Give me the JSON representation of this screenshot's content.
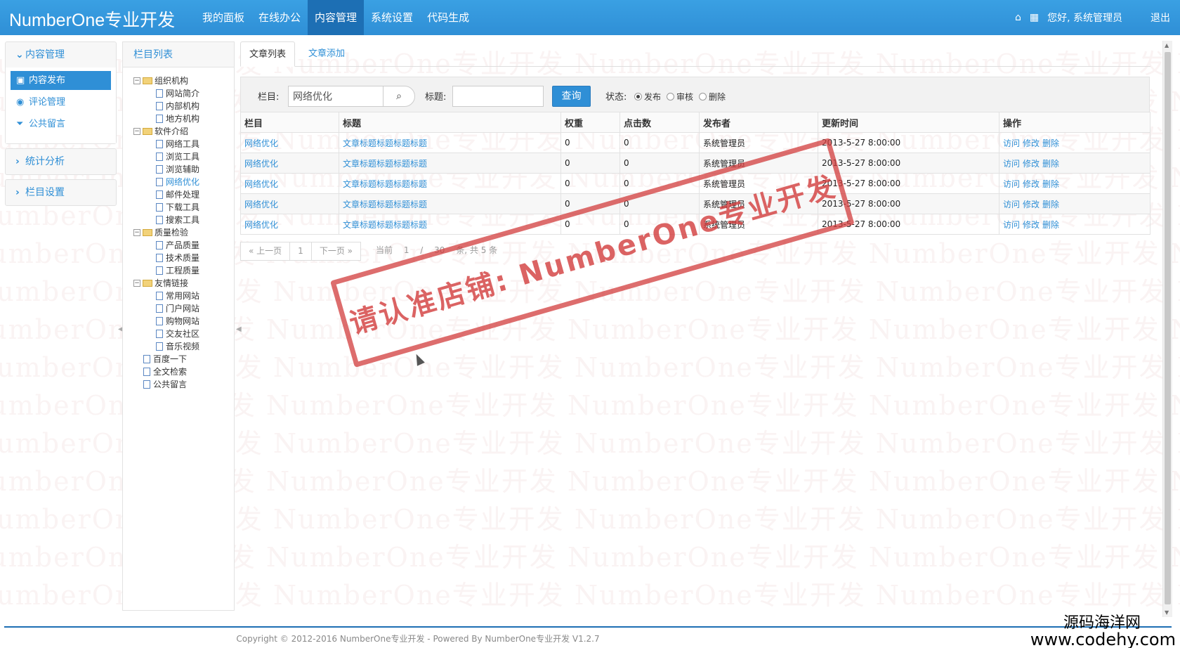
{
  "brand": "NumberOne专业开发",
  "nav": [
    "我的面板",
    "在线办公",
    "内容管理",
    "系统设置",
    "代码生成"
  ],
  "nav_active_index": 2,
  "topright": {
    "greeting": "您好, 系统管理员",
    "logout": "退出",
    "icons": [
      "home-icon",
      "grid-icon"
    ]
  },
  "sidebar": {
    "groups": [
      {
        "title": "内容管理",
        "expanded": true,
        "items": [
          {
            "label": "内容发布",
            "icon": "briefcase-icon",
            "active": true
          },
          {
            "label": "评论管理",
            "icon": "comment-icon",
            "active": false
          },
          {
            "label": "公共留言",
            "icon": "filter-icon",
            "active": false
          }
        ]
      },
      {
        "title": "统计分析",
        "expanded": false
      },
      {
        "title": "栏目设置",
        "expanded": false
      }
    ]
  },
  "tree": {
    "title": "栏目列表",
    "nodes": [
      {
        "label": "组织机构",
        "type": "folder",
        "children": [
          "网站简介",
          "内部机构",
          "地方机构"
        ]
      },
      {
        "label": "软件介绍",
        "type": "folder",
        "children": [
          "网络工具",
          "浏览工具",
          "浏览辅助",
          "网络优化",
          "邮件处理",
          "下载工具",
          "搜索工具"
        ]
      },
      {
        "label": "质量检验",
        "type": "folder",
        "children": [
          "产品质量",
          "技术质量",
          "工程质量"
        ]
      },
      {
        "label": "友情链接",
        "type": "folder",
        "children": [
          "常用网站",
          "门户网站",
          "购物网站",
          "交友社区",
          "音乐视频"
        ]
      },
      {
        "label": "百度一下",
        "type": "doc"
      },
      {
        "label": "全文检索",
        "type": "doc"
      },
      {
        "label": "公共留言",
        "type": "doc"
      }
    ],
    "selected": "网络优化"
  },
  "tabs": [
    "文章列表",
    "文章添加"
  ],
  "search": {
    "column_label": "栏目:",
    "column_value": "网络优化",
    "title_label": "标题:",
    "title_value": "",
    "query_button": "查询",
    "status_label": "状态:",
    "status_options": [
      "发布",
      "审核",
      "删除"
    ],
    "status_selected": "发布"
  },
  "table": {
    "headers": [
      "栏目",
      "标题",
      "权重",
      "点击数",
      "发布者",
      "更新时间",
      "操作"
    ],
    "rows": [
      {
        "column": "网络优化",
        "title": "文章标题标题标题标题",
        "weight": "0",
        "clicks": "0",
        "author": "系统管理员",
        "updated": "2013-5-27 8:00:00"
      },
      {
        "column": "网络优化",
        "title": "文章标题标题标题标题",
        "weight": "0",
        "clicks": "0",
        "author": "系统管理员",
        "updated": "2013-5-27 8:00:00"
      },
      {
        "column": "网络优化",
        "title": "文章标题标题标题标题",
        "weight": "0",
        "clicks": "0",
        "author": "系统管理员",
        "updated": "2013-5-27 8:00:00"
      },
      {
        "column": "网络优化",
        "title": "文章标题标题标题标题",
        "weight": "0",
        "clicks": "0",
        "author": "系统管理员",
        "updated": "2013-5-27 8:00:00"
      },
      {
        "column": "网络优化",
        "title": "文章标题标题标题标题",
        "weight": "0",
        "clicks": "0",
        "author": "系统管理员",
        "updated": "2013-5-27 8:00:00"
      }
    ],
    "actions": [
      "访问",
      "修改",
      "删除"
    ]
  },
  "pager": {
    "prev": "« 上一页",
    "current": "1",
    "next": "下一页 »",
    "info_current": "当前",
    "page": "1",
    "sep": "/",
    "per_page": "30",
    "info_tail": "条, 共 5 条"
  },
  "watermark_text": "NumberOne专业开发",
  "stamp_text": "请认准店铺: NumberOne专业开发",
  "copyright": "Copyright © 2012-2016 NumberOne专业开发 - Powered By NumberOne专业开发 V1.2.7",
  "corner_brand": {
    "line1": "源码海洋网",
    "line2": "www.codehy.com"
  },
  "colors": {
    "primary": "#2f8fd6",
    "nav_active": "#1d6fb4"
  }
}
